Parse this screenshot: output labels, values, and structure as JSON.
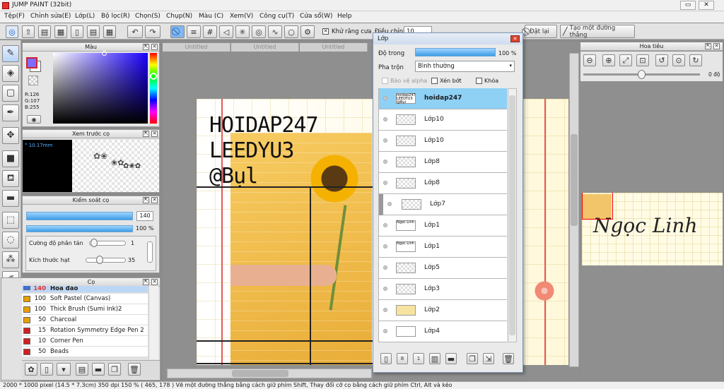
{
  "app": {
    "title": "JUMP PAINT (32bit)"
  },
  "menu": [
    "Tệp(F)",
    "Chỉnh sửa(E)",
    "Lớp(L)",
    "Bộ lọc(R)",
    "Chọn(S)",
    "Chụp(N)",
    "Màu (C)",
    "Xem(V)",
    "Công cụ(T)",
    "Cửa sổ(W)",
    "Help"
  ],
  "toolbar": {
    "antialias": "Khử răng cưa",
    "smooth_label": "Điều chỉnh",
    "smooth_value": "10",
    "reset": "Đặt lại",
    "line": "Tạo một đường thẳng"
  },
  "tabs": [
    "Untitled",
    "Untitled",
    "Untitled"
  ],
  "color_panel": {
    "title": "Màu",
    "rgb_r": "R:126",
    "rgb_g": "G:107",
    "rgb_b": "B:255",
    "primary": "#7e6bff"
  },
  "preview_panel": {
    "title": "Xem trước cọ",
    "size": "° 10.17mm"
  },
  "brush_ctrl": {
    "title": "Kiểm soát cọ",
    "size_value": "140",
    "opacity_value": "100 %",
    "scatter_label": "Cường độ phân tán",
    "scatter_value": "1",
    "grain_label": "Kích thước hạt",
    "grain_value": "35"
  },
  "brushes": {
    "title": "Cọ",
    "items": [
      {
        "size": "140",
        "name": "Hoa đào",
        "color": "#3f6fd8"
      },
      {
        "size": "100",
        "name": "Soft Pastel (Canvas)",
        "color": "#e8a000"
      },
      {
        "size": "100",
        "name": "Thick Brush (Sumi Ink)2",
        "color": "#e8a000"
      },
      {
        "size": "50",
        "name": "Charcoal",
        "color": "#e8a000"
      },
      {
        "size": "15",
        "name": "Rotation Symmetry Edge Pen 2",
        "color": "#d02020"
      },
      {
        "size": "10",
        "name": "Corner Pen",
        "color": "#d02020"
      },
      {
        "size": "50",
        "name": "Beads",
        "color": "#d02020"
      }
    ]
  },
  "canvas_text": {
    "line1": "HOIDAP247",
    "line2": "LEEDYU3",
    "line3": "@Bụl"
  },
  "layers": {
    "title": "Lớp",
    "opacity_label": "Độ trong",
    "opacity_value": "100 %",
    "blend_label": "Pha trộn",
    "blend_value": "Bình thường",
    "protect_alpha": "Bảo vệ alpha",
    "clip": "Xén bớt",
    "lock": "Khóa",
    "items": [
      {
        "name": "hoidap247",
        "thumb": "hoidap247 LEEDYU3 @Bụl"
      },
      {
        "name": "Lớp10",
        "thumb": ""
      },
      {
        "name": "Lớp10",
        "thumb": ""
      },
      {
        "name": "Lớp8",
        "thumb": ""
      },
      {
        "name": "Lớp8",
        "thumb": ""
      },
      {
        "name": "Lớp7",
        "thumb": ""
      },
      {
        "name": "Lớp1",
        "thumb": "Ngọc Linh"
      },
      {
        "name": "Lớp1",
        "thumb": "Ngọc Linh"
      },
      {
        "name": "Lớp5",
        "thumb": ""
      },
      {
        "name": "Lớp3",
        "thumb": ""
      },
      {
        "name": "Lớp2",
        "thumb": ""
      },
      {
        "name": "Lớp4",
        "thumb": ""
      }
    ]
  },
  "navigator": {
    "title": "Hoa tiêu",
    "rotation": "0 độ",
    "thumb_text": "Ngọc Linh"
  },
  "status": "2000 * 1000 pixel  (14.5 * 7.3cm)  350 dpi  150 %  ( 465, 178 )  Vẽ một đường thẳng bằng cách giữ phím Shift, Thay đổi cỡ cọ bằng cách giữ phím Ctrl, Alt và kéo"
}
